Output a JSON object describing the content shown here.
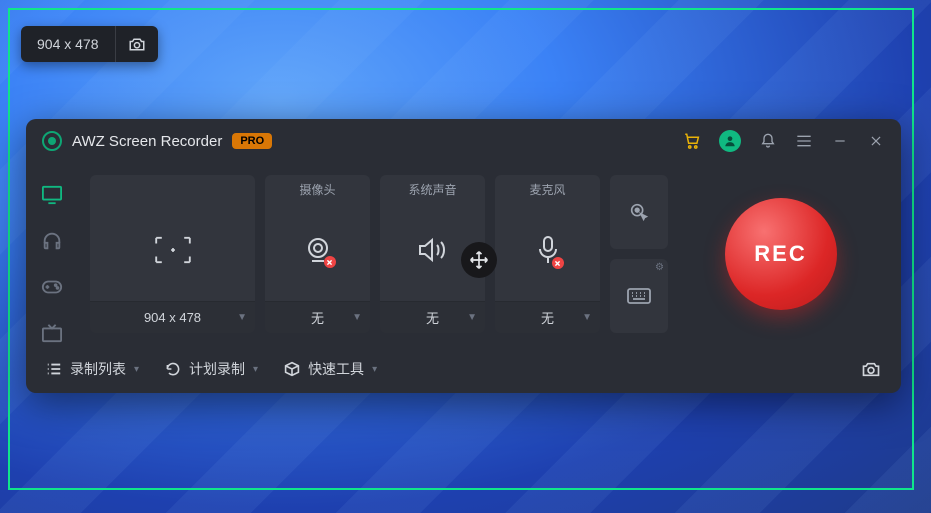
{
  "overlay": {
    "dimensions": "904 x 478"
  },
  "titlebar": {
    "app_name": "AWZ Screen Recorder",
    "badge": "PRO"
  },
  "panels": {
    "camera_label": "摄像头",
    "camera_value": "无",
    "system_label": "系统声音",
    "system_value": "无",
    "mic_label": "麦克风",
    "mic_value": "无",
    "area_value": "904 x 478"
  },
  "rec_label": "REC",
  "bottom": {
    "list": "录制列表",
    "schedule": "计划录制",
    "tools": "快速工具"
  }
}
